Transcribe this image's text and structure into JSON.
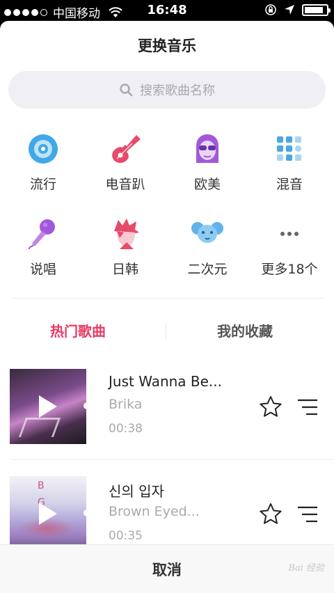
{
  "status_bar": {
    "carrier": "中国移动",
    "time": "16:48",
    "battery_level": 0.85
  },
  "sheet": {
    "title": "更换音乐"
  },
  "search": {
    "placeholder": "搜索歌曲名称"
  },
  "categories": [
    {
      "label": "流行",
      "icon": "disc-icon",
      "color": "#3fa9e8"
    },
    {
      "label": "电音趴",
      "icon": "guitar-icon",
      "color": "#e84a6a"
    },
    {
      "label": "欧美",
      "icon": "sunglasses-girl-icon",
      "color": "#a259d9"
    },
    {
      "label": "混音",
      "icon": "grid-icon",
      "color": "#4aa6e6"
    },
    {
      "label": "说唱",
      "icon": "microphone-icon",
      "color": "#a259d9"
    },
    {
      "label": "日韩",
      "icon": "anime-boy-icon",
      "color": "#e84a6a"
    },
    {
      "label": "二次元",
      "icon": "elephant-icon",
      "color": "#5fb3ea"
    },
    {
      "label": "更多18个",
      "icon": "more-icon",
      "color": "#666666"
    }
  ],
  "tabs": [
    {
      "label": "热门歌曲",
      "active": true
    },
    {
      "label": "我的收藏",
      "active": false
    }
  ],
  "songs": [
    {
      "title": "Just Wanna Be...",
      "artist": "Brika",
      "duration": "00:38"
    },
    {
      "title": "신의 입자",
      "artist": "Brown Eyed...",
      "duration": "00:35"
    }
  ],
  "cancel_label": "取消",
  "watermark": "Bai 经验",
  "colors": {
    "accent": "#e83a64",
    "muted": "#a9a9b0"
  }
}
